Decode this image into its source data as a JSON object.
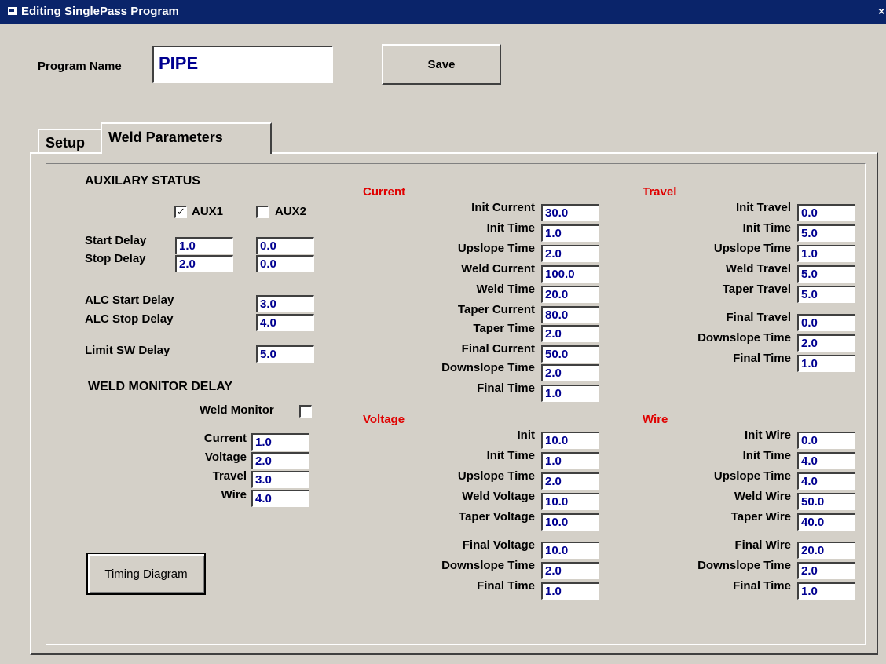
{
  "window": {
    "title": "Editing SinglePass Program",
    "close_glyph": "×"
  },
  "program": {
    "name_label": "Program Name",
    "name_value": "PIPE",
    "save_label": "Save"
  },
  "tabs": [
    {
      "label": "Setup"
    },
    {
      "label": "Weld Parameters"
    }
  ],
  "aux": {
    "heading": "AUXILARY STATUS",
    "aux1_label": "AUX1",
    "aux1_checked": true,
    "aux2_label": "AUX2",
    "aux2_checked": false,
    "start_delay_label": "Start Delay",
    "start_delay_aux1": "1.0",
    "start_delay_aux2": "0.0",
    "stop_delay_label": "Stop Delay",
    "stop_delay_aux1": "2.0",
    "stop_delay_aux2": "0.0",
    "alc_start_label": "ALC Start Delay",
    "alc_start_value": "3.0",
    "alc_stop_label": "ALC Stop Delay",
    "alc_stop_value": "4.0",
    "limit_sw_label": "Limit SW Delay",
    "limit_sw_value": "5.0"
  },
  "monitor": {
    "heading": "WELD MONITOR DELAY",
    "weld_monitor_label": "Weld Monitor",
    "weld_monitor_checked": false,
    "current_label": "Current",
    "current_value": "1.0",
    "voltage_label": "Voltage",
    "voltage_value": "2.0",
    "travel_label": "Travel",
    "travel_value": "3.0",
    "wire_label": "Wire",
    "wire_value": "4.0"
  },
  "timing_button": "Timing Diagram",
  "current": {
    "title": "Current",
    "rows": [
      {
        "label": "Init Current",
        "value": "30.0"
      },
      {
        "label": "Init Time",
        "value": "1.0"
      },
      {
        "label": "Upslope Time",
        "value": "2.0"
      },
      {
        "label": "Weld Current",
        "value": "100.0"
      },
      {
        "label": "Weld Time",
        "value": "20.0"
      },
      {
        "label": "Taper Current",
        "value": "80.0"
      },
      {
        "label": "Taper Time",
        "value": "2.0"
      },
      {
        "label": "Final Current",
        "value": "50.0"
      },
      {
        "label": "Downslope Time",
        "value": "2.0"
      },
      {
        "label": "Final Time",
        "value": "1.0"
      }
    ]
  },
  "travel": {
    "title": "Travel",
    "rows": [
      {
        "label": "Init Travel",
        "value": "0.0"
      },
      {
        "label": "Init Time",
        "value": "5.0"
      },
      {
        "label": "Upslope Time",
        "value": "1.0"
      },
      {
        "label": "Weld Travel",
        "value": "5.0"
      },
      {
        "label": "Taper Travel",
        "value": "5.0"
      },
      {
        "label": "Final Travel",
        "value": "0.0"
      },
      {
        "label": "Downslope Time",
        "value": "2.0"
      },
      {
        "label": "Final Time",
        "value": "1.0"
      }
    ]
  },
  "voltage": {
    "title": "Voltage",
    "rows": [
      {
        "label": "Init",
        "value": "10.0"
      },
      {
        "label": "Init Time",
        "value": "1.0"
      },
      {
        "label": "Upslope Time",
        "value": "2.0"
      },
      {
        "label": "Weld  Voltage",
        "value": "10.0"
      },
      {
        "label": "Taper Voltage",
        "value": "10.0"
      },
      {
        "label": "Final Voltage",
        "value": "10.0"
      },
      {
        "label": "Downslope Time",
        "value": "2.0"
      },
      {
        "label": "Final Time",
        "value": "1.0"
      }
    ]
  },
  "wire": {
    "title": "Wire",
    "rows": [
      {
        "label": "Init Wire",
        "value": "0.0"
      },
      {
        "label": "Init Time",
        "value": "4.0"
      },
      {
        "label": "Upslope Time",
        "value": "4.0"
      },
      {
        "label": "Weld Wire",
        "value": "50.0"
      },
      {
        "label": "Taper Wire",
        "value": "40.0"
      },
      {
        "label": "Final Wire",
        "value": "20.0"
      },
      {
        "label": "Downslope Time",
        "value": "2.0"
      },
      {
        "label": "Final Time",
        "value": "1.0"
      }
    ]
  }
}
